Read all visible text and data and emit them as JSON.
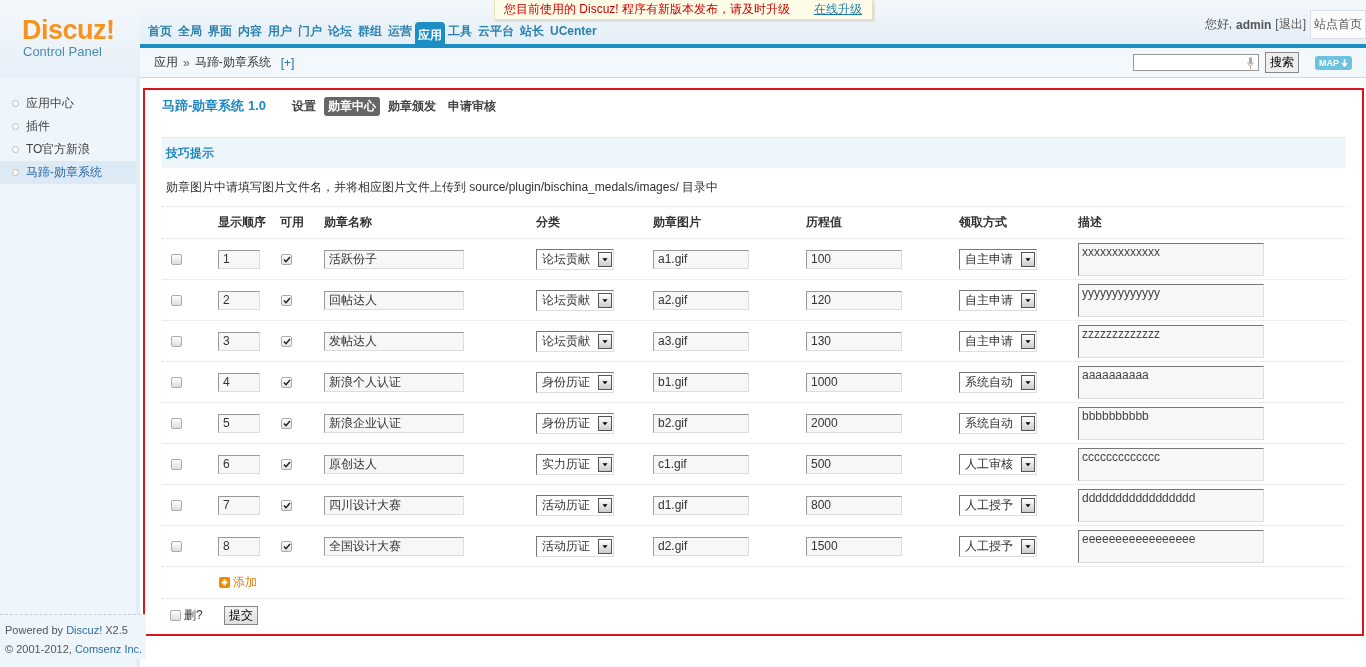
{
  "logo": {
    "brand": "Discuz!",
    "subtitle": "Control Panel"
  },
  "nav": [
    {
      "label": "首页",
      "selected": false
    },
    {
      "label": "全局",
      "selected": false
    },
    {
      "label": "界面",
      "selected": false
    },
    {
      "label": "内容",
      "selected": false
    },
    {
      "label": "用户",
      "selected": false
    },
    {
      "label": "门户",
      "selected": false
    },
    {
      "label": "论坛",
      "selected": false
    },
    {
      "label": "群组",
      "selected": false
    },
    {
      "label": "运营",
      "selected": false
    },
    {
      "label": "应用",
      "selected": true
    },
    {
      "label": "工具",
      "selected": false
    },
    {
      "label": "云平台",
      "selected": false
    },
    {
      "label": "站长",
      "selected": false
    },
    {
      "label": "UCenter",
      "selected": false
    }
  ],
  "notice": {
    "text": "您目前使用的 Discuz! 程序有新版本发布，请及时升级",
    "link": "在线升级"
  },
  "user": {
    "greeting": "您好,",
    "name": "admin",
    "logout": "[退出]",
    "home": "站点首页"
  },
  "breadcrumb": {
    "items": [
      "应用",
      "马蹄-勋章系统"
    ],
    "separator": "»",
    "add": "[+]"
  },
  "search": {
    "button": "搜索",
    "map": "MAP"
  },
  "sidebar": {
    "items": [
      {
        "label": "应用中心",
        "selected": false
      },
      {
        "label": "插件",
        "selected": false
      },
      {
        "label": "TO官方新浪",
        "selected": false
      },
      {
        "label": "马蹄-勋章系统",
        "selected": true
      }
    ]
  },
  "footer": {
    "powered": "Powered by",
    "brand": "Discuz!",
    "version": "X2.5",
    "copyright": "© 2001-2012,",
    "company": "Comsenz Inc."
  },
  "plugin": {
    "title": "马蹄-勋章系统 1.0",
    "tabs": [
      {
        "label": "设置",
        "selected": false
      },
      {
        "label": "勋章中心",
        "selected": true
      },
      {
        "label": "勋章颁发",
        "selected": false
      },
      {
        "label": "申请审核",
        "selected": false
      }
    ]
  },
  "tips": {
    "title": "技巧提示",
    "text": "勋章图片中请填写图片文件名，并将相应图片文件上传到 source/plugin/bischina_medals/images/ 目录中"
  },
  "table": {
    "columns": [
      "显示顺序",
      "可用",
      "勋章名称",
      "分类",
      "勋章图片",
      "历程值",
      "领取方式",
      "描述"
    ],
    "rows": [
      {
        "selected": false,
        "order": "1",
        "enabled": true,
        "name": "活跃份子",
        "category": "论坛贡献",
        "image": "a1.gif",
        "value": "100",
        "method": "自主申请",
        "description": "xxxxxxxxxxxxx"
      },
      {
        "selected": false,
        "order": "2",
        "enabled": true,
        "name": "回帖达人",
        "category": "论坛贡献",
        "image": "a2.gif",
        "value": "120",
        "method": "自主申请",
        "description": "yyyyyyyyyyyyy"
      },
      {
        "selected": false,
        "order": "3",
        "enabled": true,
        "name": "发帖达人",
        "category": "论坛贡献",
        "image": "a3.gif",
        "value": "130",
        "method": "自主申请",
        "description": "zzzzzzzzzzzzz"
      },
      {
        "selected": false,
        "order": "4",
        "enabled": true,
        "name": "新浪个人认证",
        "category": "身份历证",
        "image": "b1.gif",
        "value": "1000",
        "method": "系统自动",
        "description": "aaaaaaaaaa"
      },
      {
        "selected": false,
        "order": "5",
        "enabled": true,
        "name": "新浪企业认证",
        "category": "身份历证",
        "image": "b2.gif",
        "value": "2000",
        "method": "系统自动",
        "description": "bbbbbbbbbb"
      },
      {
        "selected": false,
        "order": "6",
        "enabled": true,
        "name": "原创达人",
        "category": "实力历证",
        "image": "c1.gif",
        "value": "500",
        "method": "人工审核",
        "description": "ccccccccccccc"
      },
      {
        "selected": false,
        "order": "7",
        "enabled": true,
        "name": "四川设计大赛",
        "category": "活动历证",
        "image": "d1.gif",
        "value": "800",
        "method": "人工授予",
        "description": "ddddddddddddddddd"
      },
      {
        "selected": false,
        "order": "8",
        "enabled": true,
        "name": "全国设计大赛",
        "category": "活动历证",
        "image": "d2.gif",
        "value": "1500",
        "method": "人工授予",
        "description": "eeeeeeeeeeeeeeeee"
      }
    ]
  },
  "add": "添加",
  "delete": {
    "label": "删?",
    "checked": false
  },
  "submit": "提交"
}
